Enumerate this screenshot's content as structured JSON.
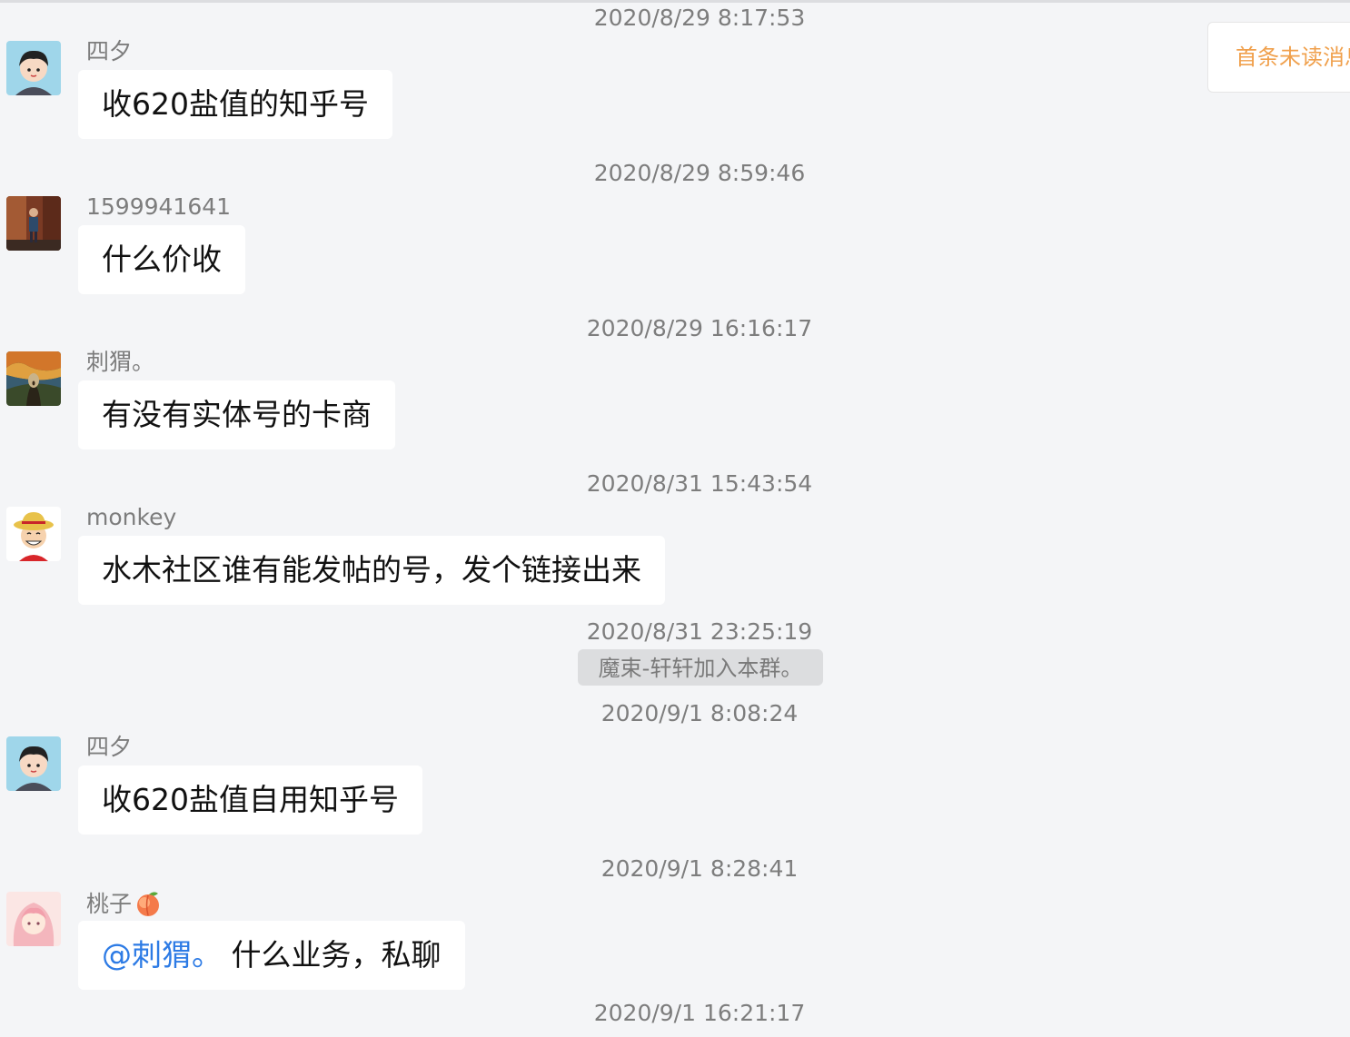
{
  "unread_button": {
    "label": "首条未读消息"
  },
  "timestamps": [
    "2020/8/29 8:17:53",
    "2020/8/29 8:59:46",
    "2020/8/29 16:16:17",
    "2020/8/31 15:43:54",
    "2020/8/31 23:25:19",
    "2020/9/1 8:08:24",
    "2020/9/1 8:28:41",
    "2020/9/1 16:21:17"
  ],
  "messages": [
    {
      "sender": "四夕",
      "text": "收620盐值的知乎号",
      "avatar": "cartoon-boy-avatar"
    },
    {
      "sender": "1599941641",
      "text": "什么价收",
      "avatar": "photo-person-avatar"
    },
    {
      "sender": "刺猬。",
      "text": "有没有实体号的卡商",
      "avatar": "scream-painting-avatar"
    },
    {
      "sender": "monkey",
      "text": "水木社区谁有能发帖的号，发个链接出来",
      "avatar": "straw-hat-avatar"
    },
    {
      "sender": "四夕",
      "text": "收620盐值自用知乎号",
      "avatar": "cartoon-boy-avatar"
    },
    {
      "sender": "桃子",
      "mention": "@刺猬。",
      "text": " 什么业务，私聊",
      "avatar": "pink-anime-avatar"
    }
  ],
  "system_message": "魔束-轩轩加入本群。",
  "colors": {
    "background": "#f4f5f7",
    "bubble": "#ffffff",
    "mention": "#2d7be5",
    "unread": "#f0a04c"
  }
}
